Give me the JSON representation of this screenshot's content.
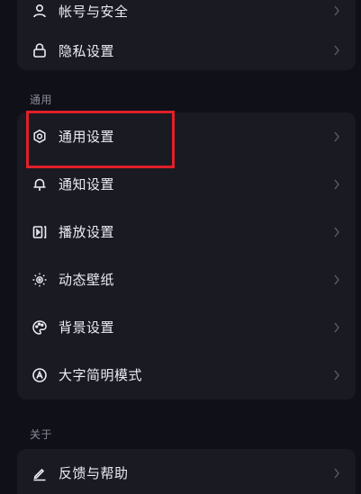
{
  "top_card": {
    "items": [
      {
        "label": "帐号与安全",
        "icon": "person-icon"
      },
      {
        "label": "隐私设置",
        "icon": "lock-icon"
      }
    ]
  },
  "general_section": {
    "title": "通用",
    "items": [
      {
        "label": "通用设置",
        "icon": "gear-icon"
      },
      {
        "label": "通知设置",
        "icon": "bell-icon"
      },
      {
        "label": "播放设置",
        "icon": "play-icon"
      },
      {
        "label": "动态壁纸",
        "icon": "dynamic-wallpaper-icon"
      },
      {
        "label": "背景设置",
        "icon": "palette-icon"
      },
      {
        "label": "大字简明模式",
        "icon": "large-font-icon"
      }
    ]
  },
  "about_section": {
    "title": "关于",
    "items": [
      {
        "label": "反馈与帮助",
        "icon": "pencil-icon"
      }
    ]
  },
  "colors": {
    "background": "#101018",
    "card": "#1a1a23",
    "highlight_border": "#e0202a",
    "section_title": "#8a8a96"
  }
}
